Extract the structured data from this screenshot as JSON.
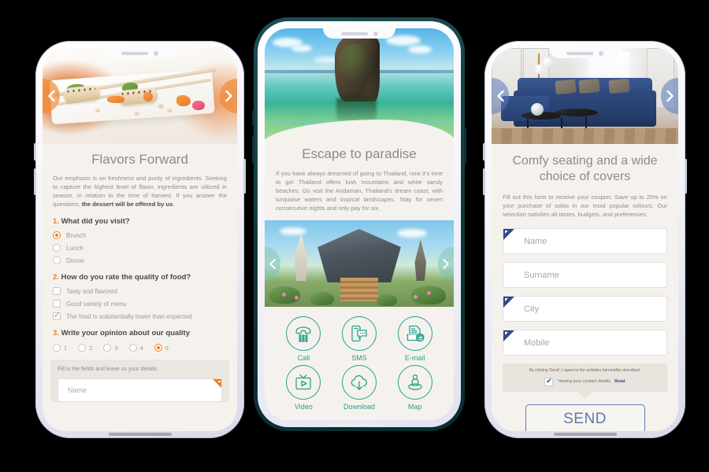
{
  "scene": {
    "background": "#000000",
    "device_count": 3
  },
  "colors": {
    "orange_accent": "#f07c24",
    "teal_accent": "#28a08c",
    "blue_accent": "#2f4a87",
    "blue_button": "#5e78ac",
    "screen_bg": "#f5f2ed",
    "frame_light": "#e1e3ef",
    "frame_dark": "#0f3a3d"
  },
  "phone1": {
    "name": "restaurant-survey-phone",
    "hero_alt": "sushi-rolls-on-white-plate",
    "nav_prev_icon": "chevron-left-icon",
    "nav_next_icon": "chevron-right-icon",
    "title": "Flavors Forward",
    "body_lead": "Our emphasis is on freshness and purity of ingredients. Seeking to capture the highest level of flavor, ingredients are utilized in season, in relation to the time of harvest. If you answer the questions, ",
    "body_bold": "the dessert will be offered by us",
    "body_tail": ".",
    "questions": [
      {
        "number": "1.",
        "text": "What did you visit?",
        "type": "radio",
        "options": [
          {
            "label": "Brunch",
            "selected": true
          },
          {
            "label": "Lunch",
            "selected": false
          },
          {
            "label": "Dinner",
            "selected": false
          }
        ]
      },
      {
        "number": "2.",
        "text": "How do you rate the quality of food?",
        "type": "checkbox",
        "options": [
          {
            "label": "Tasty and flavored",
            "selected": false
          },
          {
            "label": "Good variety of menu",
            "selected": false
          },
          {
            "label": "The food is substantially lower than expected",
            "selected": true
          }
        ]
      },
      {
        "number": "3.",
        "text": "Write your opinion about our quality",
        "type": "rating",
        "options": [
          {
            "label": "1",
            "selected": false
          },
          {
            "label": "2",
            "selected": false
          },
          {
            "label": "3",
            "selected": false
          },
          {
            "label": "4",
            "selected": false
          },
          {
            "label": "5",
            "selected": true
          }
        ]
      }
    ],
    "details_hint": "Fill in the fields and leave us your details.",
    "name_placeholder": "Name"
  },
  "phone2": {
    "name": "travel-promo-phone",
    "hero_alt": "limestone-karst-in-turquoise-sea",
    "hero2_alt": "thai-temple-with-stairs",
    "title": "Escape to paradise",
    "body": "If you have always dreamed of going to Thailand, now it's time to go! Thailand offers lush mountains and white sandy beaches. Go visit the Andaman, Thailand's dream coast, with turquoise waters and tropical landscapes. Stay for seven consecutive nights and only pay for six.",
    "nav_prev_icon": "chevron-left-icon",
    "nav_next_icon": "chevron-right-icon",
    "actions": [
      {
        "label": "Call",
        "icon": "telephone-keypad-icon"
      },
      {
        "label": "SMS",
        "icon": "message-bubble-icon"
      },
      {
        "label": "E-mail",
        "icon": "email-at-icon"
      },
      {
        "label": "Video",
        "icon": "tv-play-icon"
      },
      {
        "label": "Download",
        "icon": "cloud-download-icon"
      },
      {
        "label": "Map",
        "icon": "map-pin-person-icon"
      }
    ]
  },
  "phone3": {
    "name": "furniture-coupon-phone",
    "hero_alt": "navy-blue-sectional-sofa-in-living-room",
    "nav_prev_icon": "chevron-left-icon",
    "nav_next_icon": "chevron-right-icon",
    "title": "Comfy seating and a wide choice of covers",
    "body": "Fill out this form to receive your coupon. Save up to 20% on your purchase of sofas in our most popular colours. Our selection satisfies all tastes, budgets, and preferences.",
    "fields": [
      {
        "placeholder": "Name",
        "flag": true
      },
      {
        "placeholder": "Surname",
        "flag": false
      },
      {
        "placeholder": "City",
        "flag": true
      },
      {
        "placeholder": "Mobile",
        "flag": true
      }
    ],
    "consent_text": "By clicking 'Send', I agree to the activities hereinafter described:",
    "consent_item": "*storing your contact details",
    "consent_link": "Read",
    "consent_checked": true,
    "send_label": "SEND"
  }
}
